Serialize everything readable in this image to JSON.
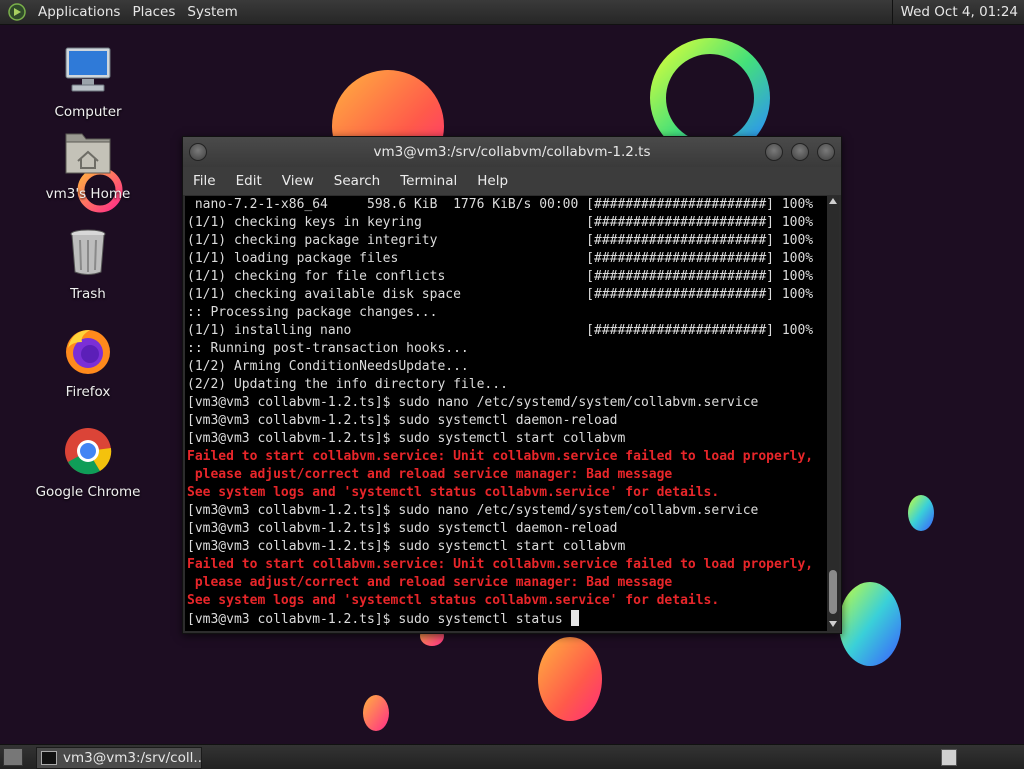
{
  "top_panel": {
    "menus": [
      "Applications",
      "Places",
      "System"
    ],
    "clock": "Wed Oct  4, 01:24"
  },
  "desktop_icons": [
    {
      "label": "Computer",
      "icon": "computer-icon"
    },
    {
      "label": "vm3's Home",
      "icon": "home-folder-icon"
    },
    {
      "label": "Trash",
      "icon": "trash-icon"
    },
    {
      "label": "Firefox",
      "icon": "firefox-icon"
    },
    {
      "label": "Google Chrome",
      "icon": "chrome-icon"
    }
  ],
  "terminal": {
    "title": "vm3@vm3:/srv/collabvm/collabvm-1.2.ts",
    "menus": [
      "File",
      "Edit",
      "View",
      "Search",
      "Terminal",
      "Help"
    ],
    "lines": [
      {
        "text": " nano-7.2-1-x86_64     598.6 KiB  1776 KiB/s 00:00 [######################] 100%",
        "error": false
      },
      {
        "text": "(1/1) checking keys in keyring                     [######################] 100%",
        "error": false
      },
      {
        "text": "(1/1) checking package integrity                   [######################] 100%",
        "error": false
      },
      {
        "text": "(1/1) loading package files                        [######################] 100%",
        "error": false
      },
      {
        "text": "(1/1) checking for file conflicts                  [######################] 100%",
        "error": false
      },
      {
        "text": "(1/1) checking available disk space                [######################] 100%",
        "error": false
      },
      {
        "text": ":: Processing package changes...",
        "error": false
      },
      {
        "text": "(1/1) installing nano                              [######################] 100%",
        "error": false
      },
      {
        "text": ":: Running post-transaction hooks...",
        "error": false
      },
      {
        "text": "(1/2) Arming ConditionNeedsUpdate...",
        "error": false
      },
      {
        "text": "(2/2) Updating the info directory file...",
        "error": false
      },
      {
        "text": "[vm3@vm3 collabvm-1.2.ts]$ sudo nano /etc/systemd/system/collabvm.service",
        "error": false
      },
      {
        "text": "[vm3@vm3 collabvm-1.2.ts]$ sudo systemctl daemon-reload",
        "error": false
      },
      {
        "text": "[vm3@vm3 collabvm-1.2.ts]$ sudo systemctl start collabvm",
        "error": false
      },
      {
        "text": "Failed to start collabvm.service: Unit collabvm.service failed to load properly,",
        "error": true
      },
      {
        "text": " please adjust/correct and reload service manager: Bad message",
        "error": true
      },
      {
        "text": "See system logs and 'systemctl status collabvm.service' for details.",
        "error": true
      },
      {
        "text": "[vm3@vm3 collabvm-1.2.ts]$ sudo nano /etc/systemd/system/collabvm.service",
        "error": false
      },
      {
        "text": "[vm3@vm3 collabvm-1.2.ts]$ sudo systemctl daemon-reload",
        "error": false
      },
      {
        "text": "[vm3@vm3 collabvm-1.2.ts]$ sudo systemctl start collabvm",
        "error": false
      },
      {
        "text": "Failed to start collabvm.service: Unit collabvm.service failed to load properly,",
        "error": true
      },
      {
        "text": " please adjust/correct and reload service manager: Bad message",
        "error": true
      },
      {
        "text": "See system logs and 'systemctl status collabvm.service' for details.",
        "error": true
      }
    ],
    "prompt_line": "[vm3@vm3 collabvm-1.2.ts]$ sudo systemctl status "
  },
  "taskbar": {
    "tasks": [
      {
        "label": "vm3@vm3:/srv/coll..."
      }
    ]
  },
  "colors": {
    "background": "#1d0d22",
    "terminal_bg": "#000000",
    "terminal_fg": "#dcdcdc",
    "error_text": "#e8262a"
  }
}
